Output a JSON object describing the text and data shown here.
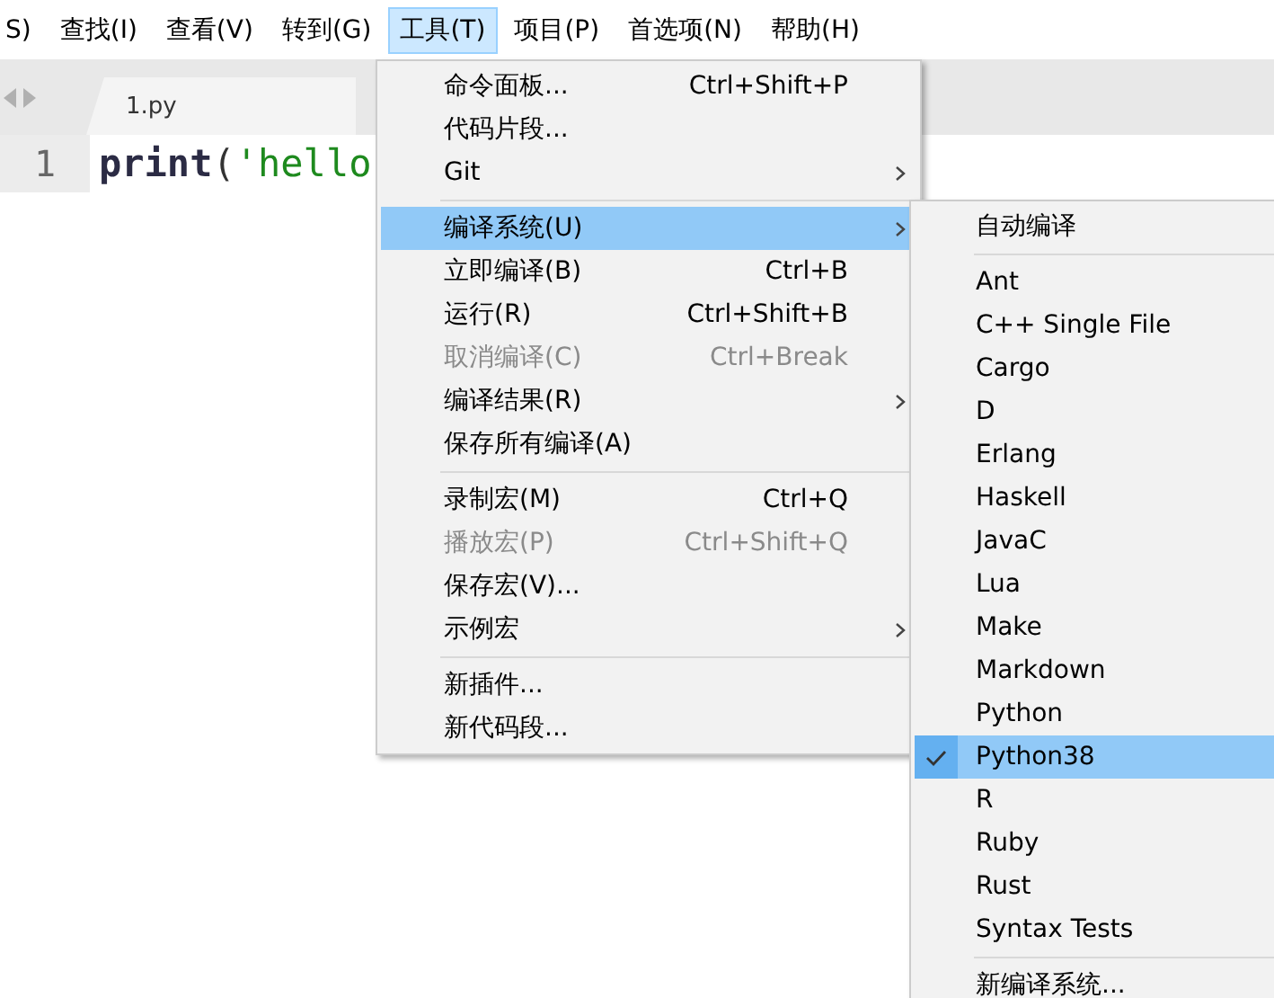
{
  "menu_bar": [
    {
      "label": "S)",
      "selected": false
    },
    {
      "label": "查找(I)",
      "selected": false
    },
    {
      "label": "查看(V)",
      "selected": false
    },
    {
      "label": "转到(G)",
      "selected": false
    },
    {
      "label": "工具(T)",
      "selected": true
    },
    {
      "label": "项目(P)",
      "selected": false
    },
    {
      "label": "首选项(N)",
      "selected": false
    },
    {
      "label": "帮助(H)",
      "selected": false
    }
  ],
  "tab": {
    "label": "1.py"
  },
  "editor": {
    "line_number": "1",
    "code": [
      {
        "kind": "func",
        "text": "print"
      },
      {
        "kind": "punct",
        "text": "("
      },
      {
        "kind": "string",
        "text": "'hello"
      }
    ]
  },
  "tools_menu": [
    {
      "kind": "item",
      "label": "命令面板...",
      "shortcut": "Ctrl+Shift+P",
      "submenu": false,
      "disabled": false,
      "selected": false
    },
    {
      "kind": "item",
      "label": "代码片段...",
      "submenu": false,
      "disabled": false,
      "selected": false
    },
    {
      "kind": "item",
      "label": "Git",
      "submenu": true,
      "disabled": false,
      "selected": false
    },
    {
      "kind": "separator"
    },
    {
      "kind": "item",
      "label": "编译系统(U)",
      "submenu": true,
      "disabled": false,
      "selected": true
    },
    {
      "kind": "item",
      "label": "立即编译(B)",
      "shortcut": "Ctrl+B",
      "submenu": false,
      "disabled": false,
      "selected": false
    },
    {
      "kind": "item",
      "label": "运行(R)",
      "shortcut": "Ctrl+Shift+B",
      "submenu": false,
      "disabled": false,
      "selected": false
    },
    {
      "kind": "item",
      "label": "取消编译(C)",
      "shortcut": "Ctrl+Break",
      "submenu": false,
      "disabled": true,
      "selected": false
    },
    {
      "kind": "item",
      "label": "编译结果(R)",
      "submenu": true,
      "disabled": false,
      "selected": false
    },
    {
      "kind": "item",
      "label": "保存所有编译(A)",
      "submenu": false,
      "disabled": false,
      "selected": false
    },
    {
      "kind": "separator"
    },
    {
      "kind": "item",
      "label": "录制宏(M)",
      "shortcut": "Ctrl+Q",
      "submenu": false,
      "disabled": false,
      "selected": false
    },
    {
      "kind": "item",
      "label": "播放宏(P)",
      "shortcut": "Ctrl+Shift+Q",
      "submenu": false,
      "disabled": true,
      "selected": false
    },
    {
      "kind": "item",
      "label": "保存宏(V)...",
      "submenu": false,
      "disabled": false,
      "selected": false
    },
    {
      "kind": "item",
      "label": "示例宏",
      "submenu": true,
      "disabled": false,
      "selected": false
    },
    {
      "kind": "separator"
    },
    {
      "kind": "item",
      "label": "新插件...",
      "submenu": false,
      "disabled": false,
      "selected": false
    },
    {
      "kind": "item",
      "label": "新代码段...",
      "submenu": false,
      "disabled": false,
      "selected": false
    }
  ],
  "build_system_menu": [
    {
      "kind": "item",
      "label": "自动编译",
      "checked": false,
      "selected": false
    },
    {
      "kind": "separator"
    },
    {
      "kind": "item",
      "label": "Ant",
      "checked": false,
      "selected": false
    },
    {
      "kind": "item",
      "label": "C++ Single File",
      "checked": false,
      "selected": false
    },
    {
      "kind": "item",
      "label": "Cargo",
      "checked": false,
      "selected": false
    },
    {
      "kind": "item",
      "label": "D",
      "checked": false,
      "selected": false
    },
    {
      "kind": "item",
      "label": "Erlang",
      "checked": false,
      "selected": false
    },
    {
      "kind": "item",
      "label": "Haskell",
      "checked": false,
      "selected": false
    },
    {
      "kind": "item",
      "label": "JavaC",
      "checked": false,
      "selected": false
    },
    {
      "kind": "item",
      "label": "Lua",
      "checked": false,
      "selected": false
    },
    {
      "kind": "item",
      "label": "Make",
      "checked": false,
      "selected": false
    },
    {
      "kind": "item",
      "label": "Markdown",
      "checked": false,
      "selected": false
    },
    {
      "kind": "item",
      "label": "Python",
      "checked": false,
      "selected": false
    },
    {
      "kind": "item",
      "label": "Python38",
      "checked": true,
      "selected": true
    },
    {
      "kind": "item",
      "label": "R",
      "checked": false,
      "selected": false
    },
    {
      "kind": "item",
      "label": "Ruby",
      "checked": false,
      "selected": false
    },
    {
      "kind": "item",
      "label": "Rust",
      "checked": false,
      "selected": false
    },
    {
      "kind": "item",
      "label": "Syntax Tests",
      "checked": false,
      "selected": false
    },
    {
      "kind": "separator"
    },
    {
      "kind": "item",
      "label": "新编译系统...",
      "checked": false,
      "selected": false
    }
  ]
}
